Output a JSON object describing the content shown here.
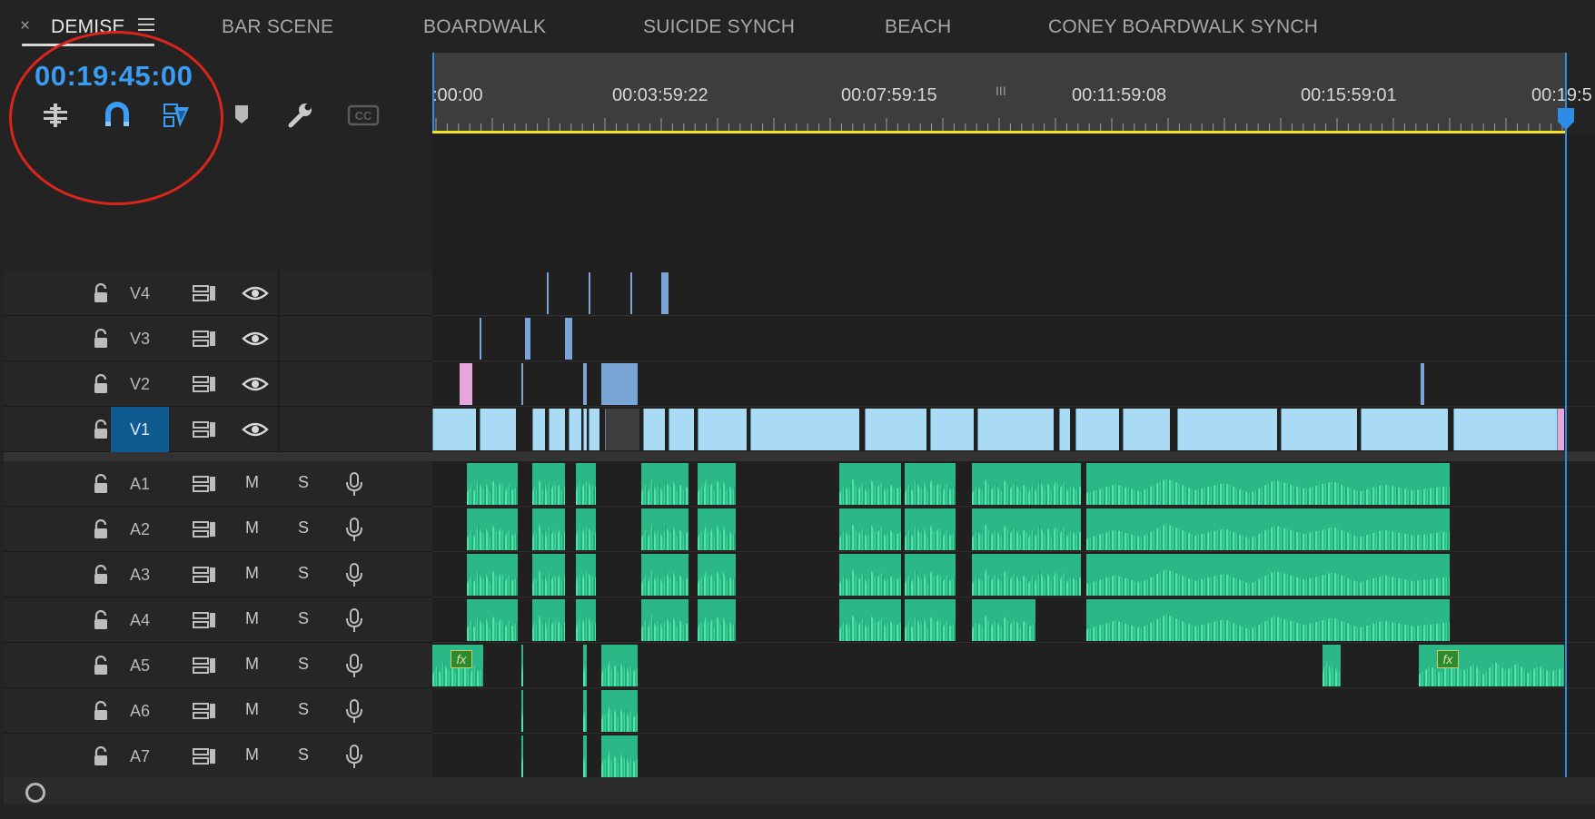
{
  "sequence_tabs": [
    {
      "label": "DEMISE",
      "active": true
    },
    {
      "label": "BAR SCENE",
      "active": false
    },
    {
      "label": "BOARDWALK",
      "active": false
    },
    {
      "label": "SUICIDE SYNCH",
      "active": false
    },
    {
      "label": "BEACH",
      "active": false
    },
    {
      "label": "CONEY BOARDWALK SYNCH",
      "active": false
    }
  ],
  "close_glyph": "×",
  "timecode": "00:19:45:00",
  "toolbar": {
    "icons": [
      "insert-nest-icon",
      "snap-magnet-icon",
      "linked-selection-icon",
      "add-marker-icon",
      "wrench-settings-icon",
      "captions-icon"
    ],
    "captions_label": "CC"
  },
  "ruler": {
    "labels": [
      ":00:00",
      "00:03:59:22",
      "00:07:59:15",
      "00:11:59:08",
      "00:15:59:01",
      "00:19:5"
    ],
    "grip": "III"
  },
  "video_tracks": [
    "V4",
    "V3",
    "V2",
    "V1"
  ],
  "audio_tracks": [
    "A1",
    "A2",
    "A3",
    "A4",
    "A5",
    "A6",
    "A7"
  ],
  "audio_controls": {
    "mute": "M",
    "solo": "S"
  },
  "fx_label": "fx",
  "colors": {
    "accent_blue": "#3a9cf2",
    "target_track": "#0f5b91",
    "video_clip": "#aadbf5",
    "audio_clip": "#2cb787",
    "work_area": "#f4e221",
    "highlight_circle": "#d9251c"
  }
}
